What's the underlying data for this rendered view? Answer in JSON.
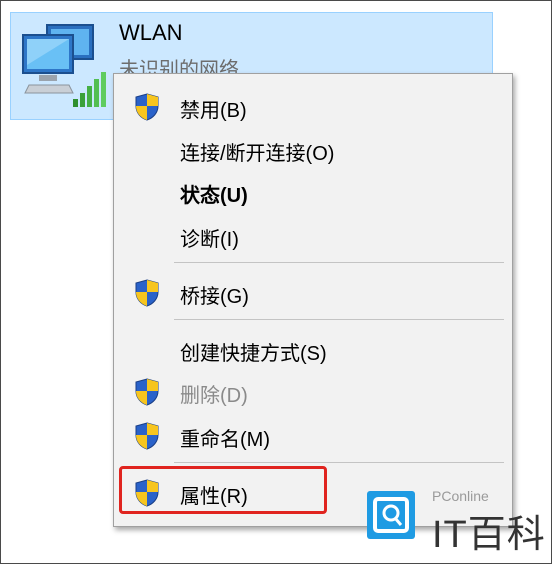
{
  "adapter": {
    "name": "WLAN",
    "status": "未识别的网络"
  },
  "menu": {
    "items": [
      {
        "label": "禁用(B)",
        "icon": "uac-shield-icon",
        "state": "normal"
      },
      {
        "label": "连接/断开连接(O)",
        "state": "normal"
      },
      {
        "label": "状态(U)",
        "state": "default-bold"
      },
      {
        "label": "诊断(I)",
        "state": "normal"
      },
      {
        "label": "桥接(G)",
        "icon": "uac-shield-icon",
        "state": "normal"
      },
      {
        "label": "创建快捷方式(S)",
        "state": "normal"
      },
      {
        "label": "删除(D)",
        "icon": "uac-shield-icon",
        "state": "disabled"
      },
      {
        "label": "重命名(M)",
        "icon": "uac-shield-icon",
        "state": "normal"
      },
      {
        "label": "属性(R)",
        "icon": "uac-shield-icon",
        "state": "normal",
        "highlighted": true
      }
    ]
  },
  "watermark": {
    "brand_top": "PConline",
    "brand_text": "IT百科"
  },
  "colors": {
    "selection_bg": "#cce8ff",
    "menu_bg": "#f2f2f2",
    "highlight_border": "#e0241f",
    "watermark_blue": "#1f9be3"
  }
}
